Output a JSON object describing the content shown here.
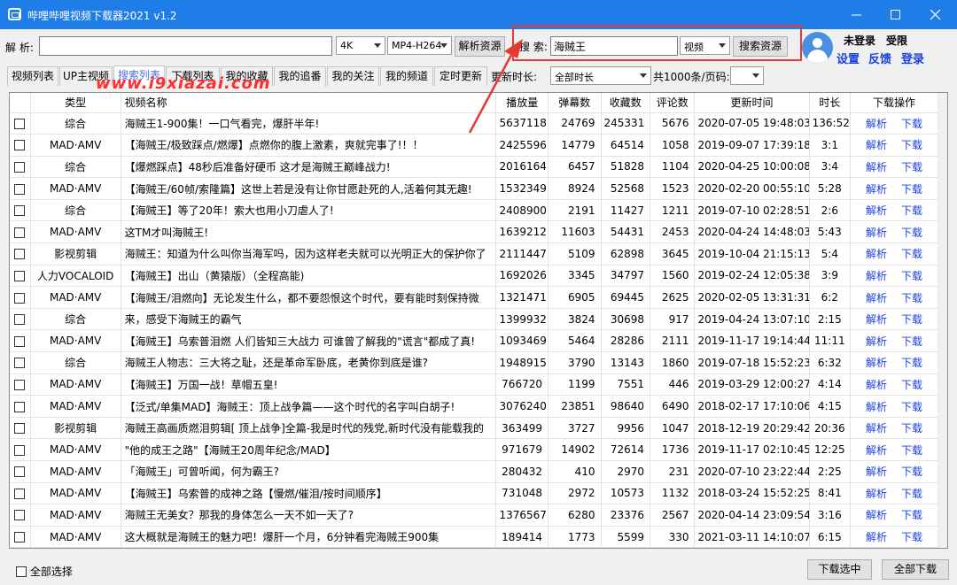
{
  "app": {
    "title": "哔哩哔哩视频下载器2021 v1.2"
  },
  "parse": {
    "label": "解 析:",
    "url_value": "",
    "quality": "4K",
    "format": "MP4-H264",
    "button": "解析资源"
  },
  "search": {
    "label": "搜 索:",
    "query": "海贼王",
    "type": "视频",
    "button": "搜索资源"
  },
  "user": {
    "status": "未登录",
    "privilege": "受限",
    "settings": "设置",
    "feedback": "反馈",
    "login": "登录"
  },
  "tabs": [
    {
      "label": "视频列表"
    },
    {
      "label": "UP主视频"
    },
    {
      "label": "搜索列表"
    },
    {
      "label": "下载列表"
    },
    {
      "label": "我的收藏"
    },
    {
      "label": "我的追番"
    },
    {
      "label": "我的关注"
    },
    {
      "label": "我的频道"
    },
    {
      "label": "定时更新"
    }
  ],
  "filters": {
    "sort_label": "更新时长:",
    "duration": "全部时长",
    "total": "共1000条/页码:",
    "page": ""
  },
  "watermark": "www.i9xiazai.com",
  "table": {
    "headers": [
      "",
      "类型",
      "视频名称",
      "播放量",
      "弹幕数",
      "收藏数",
      "评论数",
      "更新时间",
      "时长",
      "下载操作"
    ],
    "action_parse": "解析",
    "action_download": "下载",
    "rows": [
      [
        "综合",
        "海贼王1-900集！一口气看完，爆肝半年!",
        "5637118",
        "24769",
        "245331",
        "5676",
        "2020-07-05 19:48:03",
        "136:52"
      ],
      [
        "MAD·AMV",
        "【海贼王/极致踩点/燃爆】点燃你的腹上激素，爽就完事了!！！",
        "2425596",
        "14779",
        "64514",
        "1058",
        "2019-09-07 17:39:18",
        "3:1"
      ],
      [
        "综合",
        "【爆燃踩点】48秒后准备好硬币 这才是海贼王巅峰战力!",
        "2016164",
        "6457",
        "51828",
        "1104",
        "2020-04-25 10:00:08",
        "3:4"
      ],
      [
        "MAD·AMV",
        "【海贼王/60帧/索隆篇】这世上若是没有让你甘愿赴死的人,活着何其无趣!",
        "1532349",
        "8924",
        "52568",
        "1523",
        "2020-02-20 00:55:10",
        "5:28"
      ],
      [
        "综合",
        "【海贼王】等了20年！索大也用小刀虐人了!",
        "2408900",
        "2191",
        "11427",
        "1211",
        "2019-07-10 02:28:51",
        "2:6"
      ],
      [
        "MAD·AMV",
        "这TM才叫海贼王!",
        "1639212",
        "11603",
        "54431",
        "2453",
        "2020-04-24 14:48:03",
        "5:43"
      ],
      [
        "影视剪辑",
        "海贼王：知道为什么叫你当海军吗，因为这样老夫就可以光明正大的保护你了",
        "2111447",
        "5109",
        "62898",
        "3645",
        "2019-10-04 21:15:13",
        "5:4"
      ],
      [
        "人力VOCALOID",
        "【海贼王】出山（黄猿版）（全程高能)",
        "1692026",
        "3345",
        "34797",
        "1560",
        "2019-02-24 12:05:38",
        "3:9"
      ],
      [
        "MAD·AMV",
        "【海贼王/泪燃向】无论发生什么，都不要怨恨这个时代，要有能时刻保持微",
        "1321471",
        "6905",
        "69445",
        "2625",
        "2020-02-05 13:31:31",
        "6:2"
      ],
      [
        "综合",
        "来，感受下海贼王的霸气",
        "1399932",
        "3824",
        "30698",
        "917",
        "2019-04-24 13:07:10",
        "2:15"
      ],
      [
        "MAD·AMV",
        "【海贼王】乌索普泪燃 人们皆知三大战力 可谁曾了解我的\"谎言\"都成了真!",
        "1093469",
        "5464",
        "28286",
        "2111",
        "2019-11-17 19:14:44",
        "11:11"
      ],
      [
        "综合",
        "海贼王人物志：三大将之耻，还是革命军卧底，老黄你到底是谁?",
        "1948915",
        "3790",
        "13143",
        "1860",
        "2019-07-18 15:52:23",
        "6:32"
      ],
      [
        "MAD·AMV",
        "【海贼王】万国一战！草帽五皇!",
        "766720",
        "1199",
        "7551",
        "446",
        "2019-03-29 12:00:27",
        "4:14"
      ],
      [
        "MAD·AMV",
        "【泛式/单集MAD】海贼王：顶上战争篇——这个时代的名字叫白胡子!",
        "3076240",
        "23851",
        "98640",
        "6490",
        "2018-02-17 17:10:06",
        "4:15"
      ],
      [
        "影视剪辑",
        "海贼王高画质燃泪剪辑[ 顶上战争]全篇-我是时代的残党,新时代没有能载我的",
        "363499",
        "3727",
        "9956",
        "1047",
        "2018-12-19 20:29:42",
        "20:36"
      ],
      [
        "MAD·AMV",
        "\"他的成王之路\"【海贼王20周年纪念/MAD】",
        "971679",
        "14902",
        "72614",
        "1736",
        "2019-11-17 02:10:45",
        "12:25"
      ],
      [
        "MAD·AMV",
        "「海贼王」可曾听闻，何为霸王?",
        "280432",
        "410",
        "2970",
        "231",
        "2020-07-10 23:22:44",
        "2:25"
      ],
      [
        "MAD·AMV",
        "【海贼王】乌索普的成神之路【慢燃/催泪/按时间顺序】",
        "731048",
        "2972",
        "10573",
        "1132",
        "2018-03-24 15:52:25",
        "8:41"
      ],
      [
        "MAD·AMV",
        "海贼王无美女？那我的身体怎么一天不如一天了?",
        "1376567",
        "6280",
        "23376",
        "2567",
        "2020-04-14 23:09:54",
        "3:16"
      ],
      [
        "MAD·AMV",
        "这大概就是海贼王的魅力吧！爆肝一个月，6分钟看完海贼王900集",
        "189414",
        "1773",
        "5599",
        "330",
        "2021-03-11 14:10:07",
        "6:15"
      ]
    ]
  },
  "footer": {
    "select_all": "全部选择",
    "download_selected": "下载选中",
    "download_all": "全部下载"
  },
  "colors": {
    "titlebar": "#1e7de6",
    "accent_link": "#1a3fe0",
    "highlight": "#e53935"
  }
}
